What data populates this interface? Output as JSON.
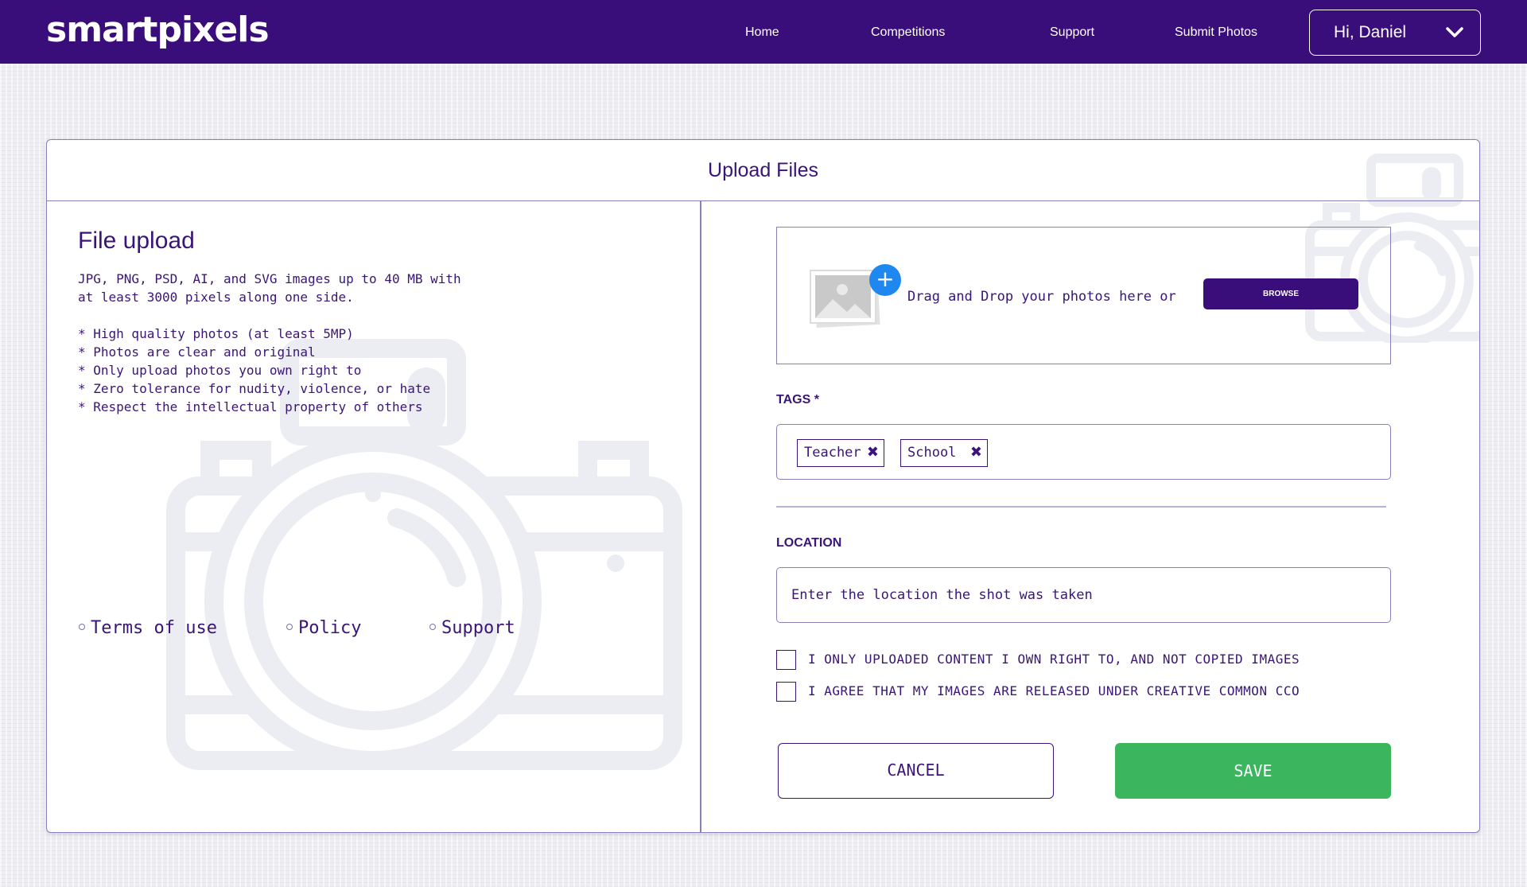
{
  "navbar": {
    "logo": "smartpixels",
    "links": [
      "Home",
      "Competitions",
      "Support",
      "Submit Photos"
    ],
    "user_greeting": "Hi, Daniel",
    "background": "#3a0e7a"
  },
  "card": {
    "title": "Upload Files"
  },
  "left": {
    "title": "File upload",
    "description_lines": [
      "JPG, PNG, PSD, AI, and SVG images up to 40 MB with",
      "at least 3000 pixels along one side."
    ],
    "rules": [
      "* High quality photos (at least 5MP)",
      "* Photos are clear and original",
      "* Only upload photos you own right to",
      "* Zero tolerance for nudity, violence, or hate",
      "* Respect the intellectual property of others"
    ],
    "footer_links": [
      "Terms of use",
      "Policy",
      "Support"
    ]
  },
  "dropzone": {
    "text": "Drag and Drop your photos here or",
    "browse_label": "BROWSE",
    "plus_icon": "+"
  },
  "tags": {
    "label": "TAGS *",
    "items": [
      "Teacher",
      "School"
    ],
    "remove_icon": "✖"
  },
  "location": {
    "label": "LOCATION",
    "placeholder": "Enter the location the shot was taken"
  },
  "agreements": [
    "I ONLY UPLOADED CONTENT I OWN RIGHT TO, AND NOT COPIED IMAGES",
    "I AGREE THAT MY IMAGES ARE RELEASED UNDER CREATIVE COMMON CCO"
  ],
  "actions": {
    "cancel": "CANCEL",
    "save": "SAVE",
    "save_color": "#3bb55e"
  }
}
